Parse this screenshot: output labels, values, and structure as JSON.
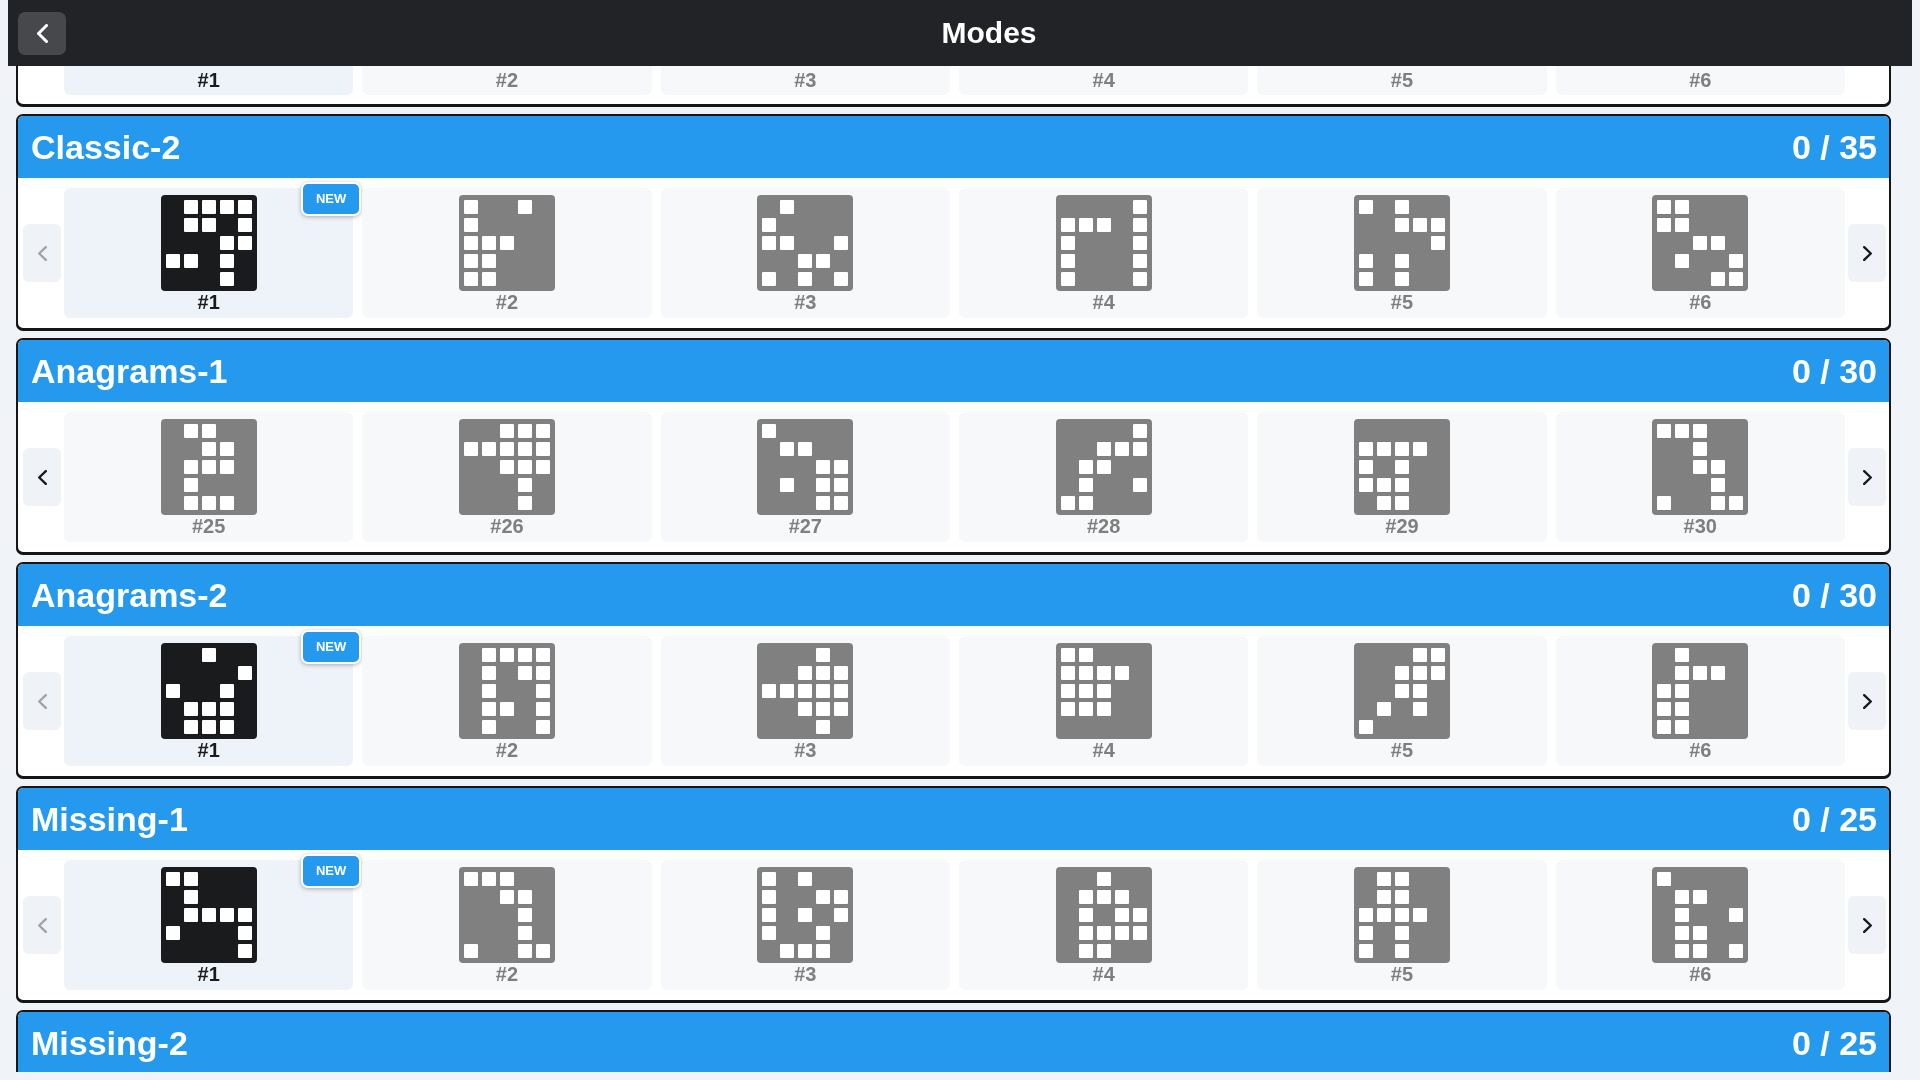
{
  "header": {
    "title": "Modes"
  },
  "sections": [
    {
      "tiles": [
        {
          "label": "#1",
          "selected": true
        },
        {
          "label": "#2",
          "selected": false
        },
        {
          "label": "#3",
          "selected": false
        },
        {
          "label": "#4",
          "selected": false
        },
        {
          "label": "#5",
          "selected": false
        },
        {
          "label": "#6",
          "selected": false
        }
      ]
    },
    {
      "title": "Classic-2",
      "count": "0 / 35",
      "prev": {
        "disabled": true
      },
      "next": {
        "disabled": false
      },
      "tiles": [
        {
          "label": "#1",
          "selected": true,
          "badge": "NEW"
        },
        {
          "label": "#2",
          "selected": false
        },
        {
          "label": "#3",
          "selected": false
        },
        {
          "label": "#4",
          "selected": false
        },
        {
          "label": "#5",
          "selected": false
        },
        {
          "label": "#6",
          "selected": false
        }
      ]
    },
    {
      "title": "Anagrams-1",
      "count": "0 / 30",
      "prev": {
        "disabled": false
      },
      "next": {
        "disabled": false
      },
      "tiles": [
        {
          "label": "#25",
          "selected": false
        },
        {
          "label": "#26",
          "selected": false
        },
        {
          "label": "#27",
          "selected": false
        },
        {
          "label": "#28",
          "selected": false
        },
        {
          "label": "#29",
          "selected": false
        },
        {
          "label": "#30",
          "selected": false
        }
      ]
    },
    {
      "title": "Anagrams-2",
      "count": "0 / 30",
      "prev": {
        "disabled": true
      },
      "next": {
        "disabled": false
      },
      "tiles": [
        {
          "label": "#1",
          "selected": true,
          "badge": "NEW"
        },
        {
          "label": "#2",
          "selected": false
        },
        {
          "label": "#3",
          "selected": false
        },
        {
          "label": "#4",
          "selected": false
        },
        {
          "label": "#5",
          "selected": false
        },
        {
          "label": "#6",
          "selected": false
        }
      ]
    },
    {
      "title": "Missing-1",
      "count": "0 / 25",
      "prev": {
        "disabled": true
      },
      "next": {
        "disabled": false
      },
      "tiles": [
        {
          "label": "#1",
          "selected": true,
          "badge": "NEW"
        },
        {
          "label": "#2",
          "selected": false
        },
        {
          "label": "#3",
          "selected": false
        },
        {
          "label": "#4",
          "selected": false
        },
        {
          "label": "#5",
          "selected": false
        },
        {
          "label": "#6",
          "selected": false
        }
      ]
    },
    {
      "title": "Missing-2",
      "count": "0 / 25"
    }
  ]
}
